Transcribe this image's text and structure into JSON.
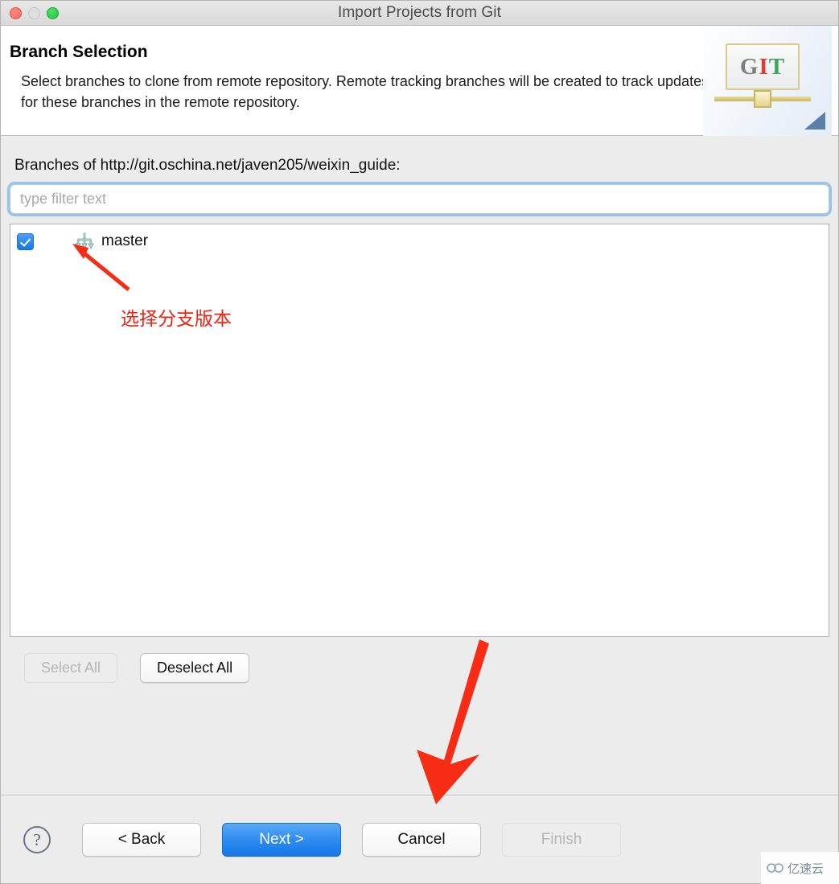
{
  "window": {
    "title": "Import Projects from Git",
    "traffic_lights": [
      "close",
      "minimize",
      "maximize"
    ]
  },
  "header": {
    "title": "Branch Selection",
    "description": "Select branches to clone from remote repository. Remote tracking branches will be created to track updates for these branches in the remote repository.",
    "logo": {
      "g": "G",
      "i": "I",
      "t": "T"
    }
  },
  "main": {
    "branches_label": "Branches of http://git.oschina.net/javen205/weixin_guide:",
    "filter": {
      "value": "",
      "placeholder": "type filter text"
    },
    "branches": [
      {
        "name": "master",
        "checked": true
      }
    ],
    "select_all_label": "Select All",
    "select_all_enabled": false,
    "deselect_all_label": "Deselect All",
    "deselect_all_enabled": true
  },
  "footer": {
    "help_label": "?",
    "buttons": [
      {
        "label": "< Back",
        "style": "normal",
        "enabled": true
      },
      {
        "label": "Next >",
        "style": "primary",
        "enabled": true
      },
      {
        "label": "Cancel",
        "style": "normal",
        "enabled": true
      },
      {
        "label": "Finish",
        "style": "disabled",
        "enabled": false
      }
    ]
  },
  "annotations": {
    "note_text": "选择分支版本",
    "note_color": "#ef2212",
    "arrow_color": "#f72c14"
  },
  "watermark": {
    "text": "亿速云"
  }
}
